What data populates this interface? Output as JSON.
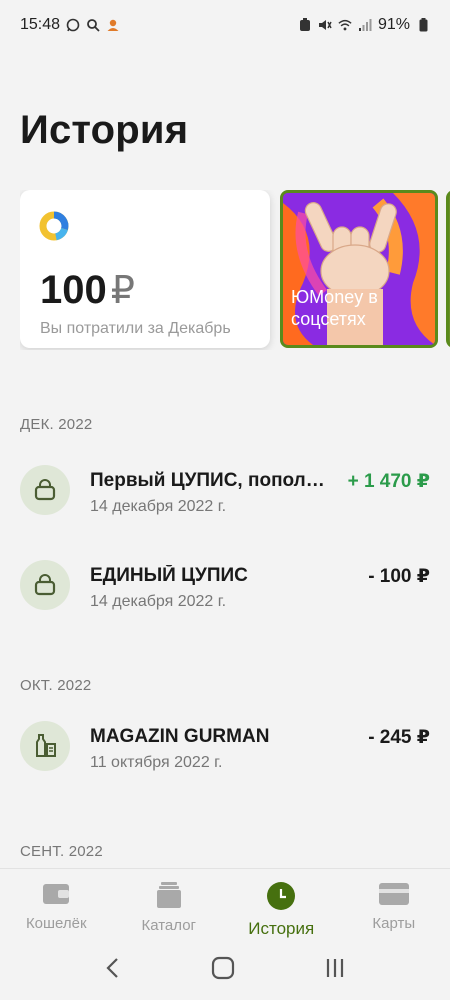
{
  "status_bar": {
    "time": "15:48",
    "battery": "91%"
  },
  "page": {
    "title": "История"
  },
  "cards": {
    "spend": {
      "amount": "100",
      "currency": "₽",
      "caption": "Вы потратили за Декабрь"
    },
    "promo": {
      "text": "ЮMoney в соцсетях"
    }
  },
  "sections": [
    {
      "header": "ДЕК. 2022",
      "transactions": [
        {
          "title": "Первый ЦУПИС, попол…",
          "date": "14 декабря 2022 г.",
          "amount": "+ 1 470 ₽",
          "icon": "shopping-bag-icon"
        },
        {
          "title": "ЕДИНЫЙ ЦУПИС",
          "date": "14 декабря 2022 г.",
          "amount": "- 100 ₽",
          "icon": "shopping-bag-icon"
        }
      ]
    },
    {
      "header": "ОКТ. 2022",
      "transactions": [
        {
          "title": "MAGAZIN GURMAN",
          "date": "11 октября 2022 г.",
          "amount": "- 245 ₽",
          "icon": "grocery-bottle-icon"
        }
      ]
    },
    {
      "header": "СЕНТ. 2022",
      "transactions": []
    }
  ],
  "bottom_nav": [
    {
      "label": "Кошелёк",
      "icon": "wallet-icon",
      "active": false
    },
    {
      "label": "Каталог",
      "icon": "catalog-icon",
      "active": false
    },
    {
      "label": "История",
      "icon": "clock-icon",
      "active": true
    },
    {
      "label": "Карты",
      "icon": "card-icon",
      "active": false
    }
  ],
  "colors": {
    "accent": "#46700f",
    "positive": "#2b9b4a",
    "icon_bg": "#dfe7d7"
  }
}
